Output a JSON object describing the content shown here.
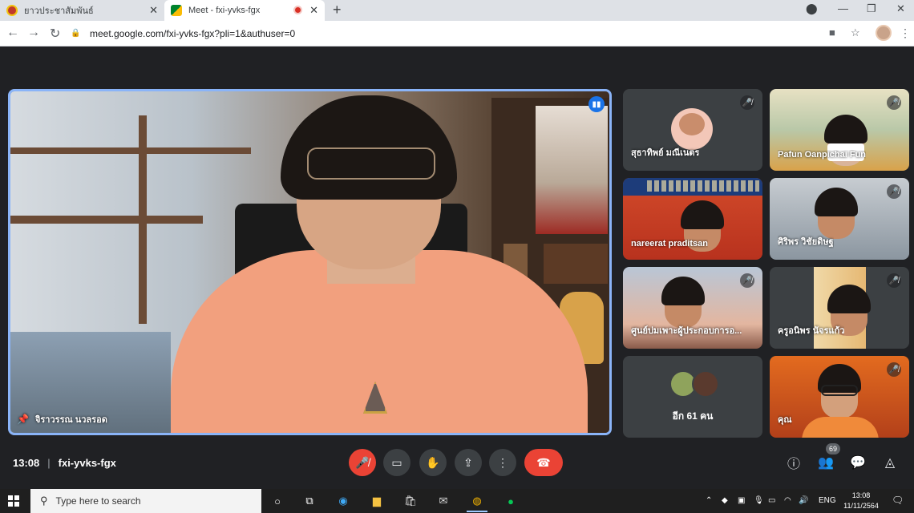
{
  "browser": {
    "tabs": [
      {
        "label": "ยาวประชาสัมพันธ์",
        "active": false
      },
      {
        "label": "Meet - fxi-yvks-fgx",
        "active": true
      }
    ],
    "new_tab_label": "+",
    "address": "meet.google.com/fxi-yvks-fgx?pli=1&authuser=0"
  },
  "meeting": {
    "main_speaker": {
      "name": "จิราวรรณ นวลรอด",
      "speaking": true
    },
    "participants": [
      {
        "name": "สุธาทิพย์ มณีเนตร",
        "muted": true
      },
      {
        "name": "Pafun Oanpichai Fun",
        "muted": true
      },
      {
        "name": "nareerat praditsan",
        "muted": false
      },
      {
        "name": "ศิริพร วิชัยดิษฐ",
        "muted": true
      },
      {
        "name": "ศูนย์บ่มเพาะผู้ประกอบการอ...",
        "muted": true
      },
      {
        "name": "ครูอนิพร นัจรแก้ว",
        "muted": true
      },
      {
        "name": "อีก 61 คน",
        "more": true
      },
      {
        "name": "คุณ",
        "muted": true
      }
    ],
    "time": "13:08",
    "code": "fxi-yvks-fgx",
    "people_count": "69"
  },
  "taskbar": {
    "search_placeholder": "Type here to search",
    "language": "ENG",
    "time": "13:08",
    "date": "11/11/2564"
  },
  "colors": {
    "accent_blue": "#8ab4f8",
    "leave_red": "#ea4335",
    "meet_bg": "#202124"
  }
}
